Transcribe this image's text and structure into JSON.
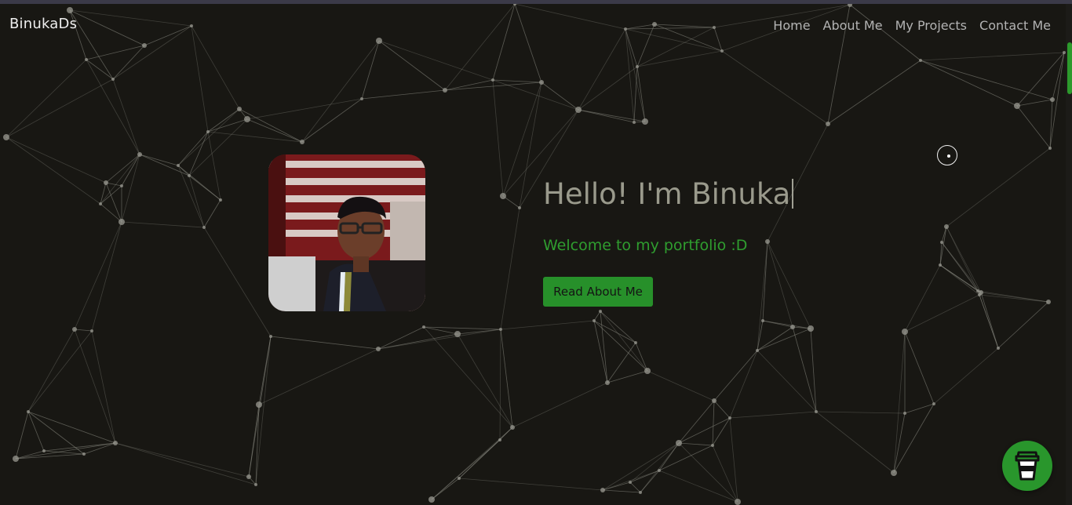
{
  "brand": {
    "name": "BinukaDs"
  },
  "nav": {
    "items": [
      "Home",
      "About Me",
      "My Projects",
      "Contact Me"
    ]
  },
  "hero": {
    "greeting": "Hello! I'm Binuka",
    "subtitle": "Welcome to my portfolio :D",
    "button_label": "Read About Me"
  },
  "colors": {
    "background": "#181713",
    "accent": "#2f9d2f",
    "button": "#27902a"
  },
  "icons": {
    "floating_button": "coffee-cup-icon",
    "cursor": "cursor-ring-icon"
  }
}
